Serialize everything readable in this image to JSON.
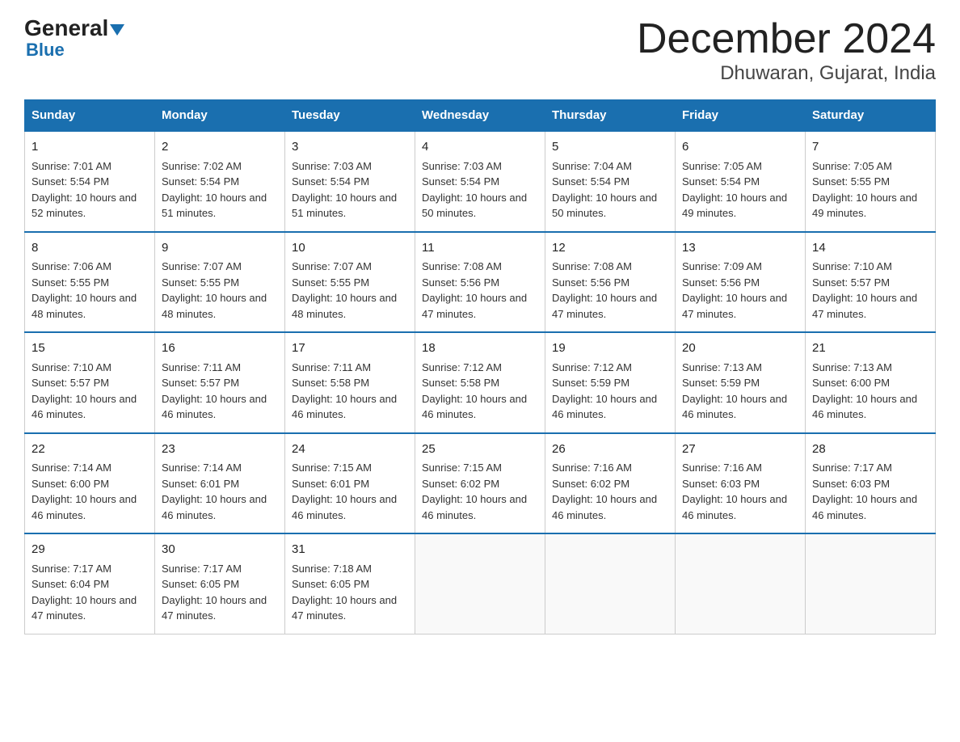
{
  "logo": {
    "general": "General",
    "blue": "Blue"
  },
  "title": "December 2024",
  "subtitle": "Dhuwaran, Gujarat, India",
  "days_of_week": [
    "Sunday",
    "Monday",
    "Tuesday",
    "Wednesday",
    "Thursday",
    "Friday",
    "Saturday"
  ],
  "weeks": [
    [
      {
        "day": 1,
        "sunrise": "7:01 AM",
        "sunset": "5:54 PM",
        "daylight": "10 hours and 52 minutes."
      },
      {
        "day": 2,
        "sunrise": "7:02 AM",
        "sunset": "5:54 PM",
        "daylight": "10 hours and 51 minutes."
      },
      {
        "day": 3,
        "sunrise": "7:03 AM",
        "sunset": "5:54 PM",
        "daylight": "10 hours and 51 minutes."
      },
      {
        "day": 4,
        "sunrise": "7:03 AM",
        "sunset": "5:54 PM",
        "daylight": "10 hours and 50 minutes."
      },
      {
        "day": 5,
        "sunrise": "7:04 AM",
        "sunset": "5:54 PM",
        "daylight": "10 hours and 50 minutes."
      },
      {
        "day": 6,
        "sunrise": "7:05 AM",
        "sunset": "5:54 PM",
        "daylight": "10 hours and 49 minutes."
      },
      {
        "day": 7,
        "sunrise": "7:05 AM",
        "sunset": "5:55 PM",
        "daylight": "10 hours and 49 minutes."
      }
    ],
    [
      {
        "day": 8,
        "sunrise": "7:06 AM",
        "sunset": "5:55 PM",
        "daylight": "10 hours and 48 minutes."
      },
      {
        "day": 9,
        "sunrise": "7:07 AM",
        "sunset": "5:55 PM",
        "daylight": "10 hours and 48 minutes."
      },
      {
        "day": 10,
        "sunrise": "7:07 AM",
        "sunset": "5:55 PM",
        "daylight": "10 hours and 48 minutes."
      },
      {
        "day": 11,
        "sunrise": "7:08 AM",
        "sunset": "5:56 PM",
        "daylight": "10 hours and 47 minutes."
      },
      {
        "day": 12,
        "sunrise": "7:08 AM",
        "sunset": "5:56 PM",
        "daylight": "10 hours and 47 minutes."
      },
      {
        "day": 13,
        "sunrise": "7:09 AM",
        "sunset": "5:56 PM",
        "daylight": "10 hours and 47 minutes."
      },
      {
        "day": 14,
        "sunrise": "7:10 AM",
        "sunset": "5:57 PM",
        "daylight": "10 hours and 47 minutes."
      }
    ],
    [
      {
        "day": 15,
        "sunrise": "7:10 AM",
        "sunset": "5:57 PM",
        "daylight": "10 hours and 46 minutes."
      },
      {
        "day": 16,
        "sunrise": "7:11 AM",
        "sunset": "5:57 PM",
        "daylight": "10 hours and 46 minutes."
      },
      {
        "day": 17,
        "sunrise": "7:11 AM",
        "sunset": "5:58 PM",
        "daylight": "10 hours and 46 minutes."
      },
      {
        "day": 18,
        "sunrise": "7:12 AM",
        "sunset": "5:58 PM",
        "daylight": "10 hours and 46 minutes."
      },
      {
        "day": 19,
        "sunrise": "7:12 AM",
        "sunset": "5:59 PM",
        "daylight": "10 hours and 46 minutes."
      },
      {
        "day": 20,
        "sunrise": "7:13 AM",
        "sunset": "5:59 PM",
        "daylight": "10 hours and 46 minutes."
      },
      {
        "day": 21,
        "sunrise": "7:13 AM",
        "sunset": "6:00 PM",
        "daylight": "10 hours and 46 minutes."
      }
    ],
    [
      {
        "day": 22,
        "sunrise": "7:14 AM",
        "sunset": "6:00 PM",
        "daylight": "10 hours and 46 minutes."
      },
      {
        "day": 23,
        "sunrise": "7:14 AM",
        "sunset": "6:01 PM",
        "daylight": "10 hours and 46 minutes."
      },
      {
        "day": 24,
        "sunrise": "7:15 AM",
        "sunset": "6:01 PM",
        "daylight": "10 hours and 46 minutes."
      },
      {
        "day": 25,
        "sunrise": "7:15 AM",
        "sunset": "6:02 PM",
        "daylight": "10 hours and 46 minutes."
      },
      {
        "day": 26,
        "sunrise": "7:16 AM",
        "sunset": "6:02 PM",
        "daylight": "10 hours and 46 minutes."
      },
      {
        "day": 27,
        "sunrise": "7:16 AM",
        "sunset": "6:03 PM",
        "daylight": "10 hours and 46 minutes."
      },
      {
        "day": 28,
        "sunrise": "7:17 AM",
        "sunset": "6:03 PM",
        "daylight": "10 hours and 46 minutes."
      }
    ],
    [
      {
        "day": 29,
        "sunrise": "7:17 AM",
        "sunset": "6:04 PM",
        "daylight": "10 hours and 47 minutes."
      },
      {
        "day": 30,
        "sunrise": "7:17 AM",
        "sunset": "6:05 PM",
        "daylight": "10 hours and 47 minutes."
      },
      {
        "day": 31,
        "sunrise": "7:18 AM",
        "sunset": "6:05 PM",
        "daylight": "10 hours and 47 minutes."
      },
      null,
      null,
      null,
      null
    ]
  ]
}
